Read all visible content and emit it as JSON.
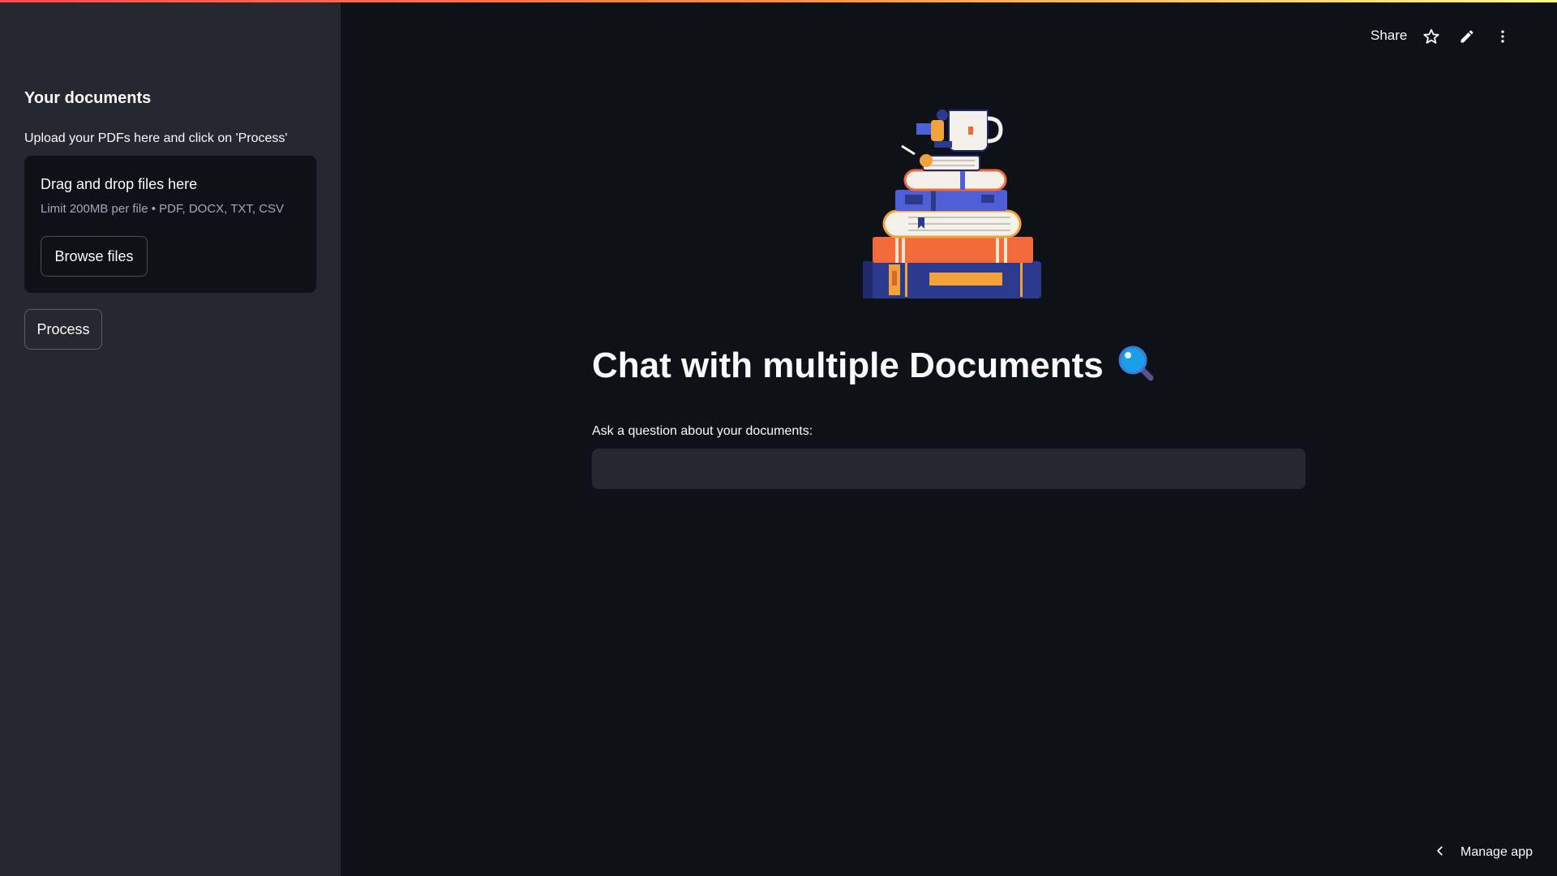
{
  "sidebar": {
    "heading": "Your documents",
    "hint": "Upload your PDFs here and click on 'Process'",
    "uploader": {
      "title": "Drag and drop files here",
      "limit": "Limit 200MB per file • PDF, DOCX, TXT, CSV",
      "browse_label": "Browse files"
    },
    "process_label": "Process"
  },
  "header": {
    "share_label": "Share",
    "icons": [
      "star-icon",
      "pencil-icon",
      "more-vertical-icon"
    ]
  },
  "main": {
    "title": "Chat with multiple Documents",
    "title_icon": "magnifying-glass-icon",
    "question_label": "Ask a question about your documents:",
    "question_value": ""
  },
  "footer": {
    "manage_label": "Manage app",
    "icon": "chevron-left-icon"
  },
  "colors": {
    "background": "#0e1117",
    "sidebar": "#262730",
    "text": "#fafafa",
    "accent": "#ff4b4b"
  }
}
